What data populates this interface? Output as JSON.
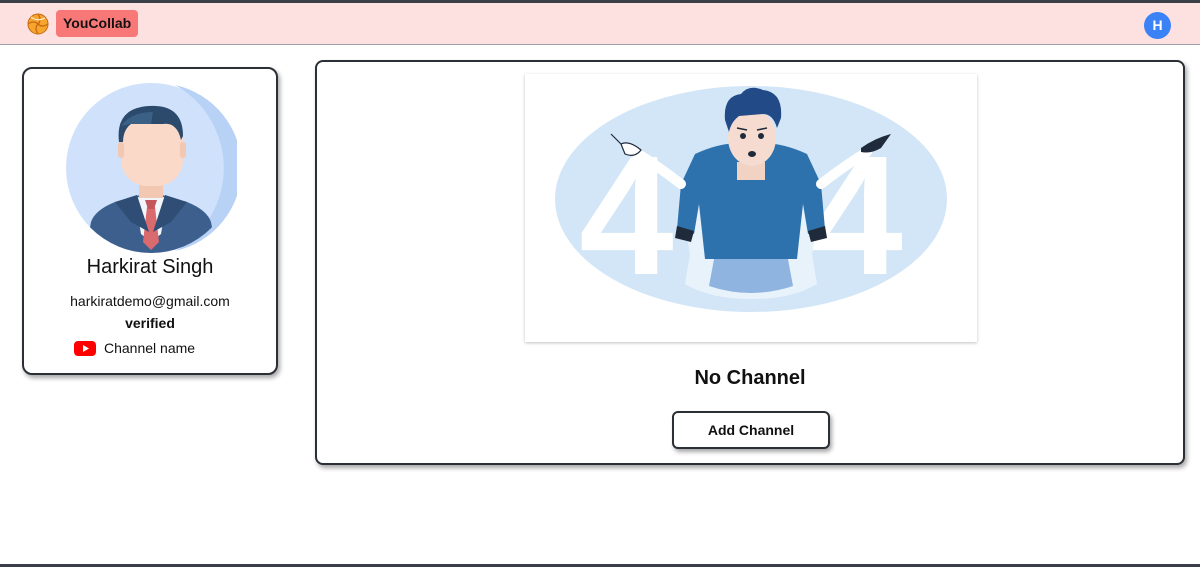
{
  "navbar": {
    "brand": "YouCollab",
    "user_initial": "H",
    "colors": {
      "background": "#fde1e1",
      "brand_bg": "#f87878",
      "avatar_bg": "#3b82f6"
    }
  },
  "profile": {
    "name": "Harkirat Singh",
    "email": "harkiratdemo@gmail.com",
    "status": "verified",
    "channel_label": "Channel name",
    "icons": {
      "avatar": "user-avatar-illustration",
      "channel": "youtube-icon"
    }
  },
  "main": {
    "illustration": "404-not-found-illustration",
    "message": "No Channel",
    "add_button": "Add Channel"
  }
}
